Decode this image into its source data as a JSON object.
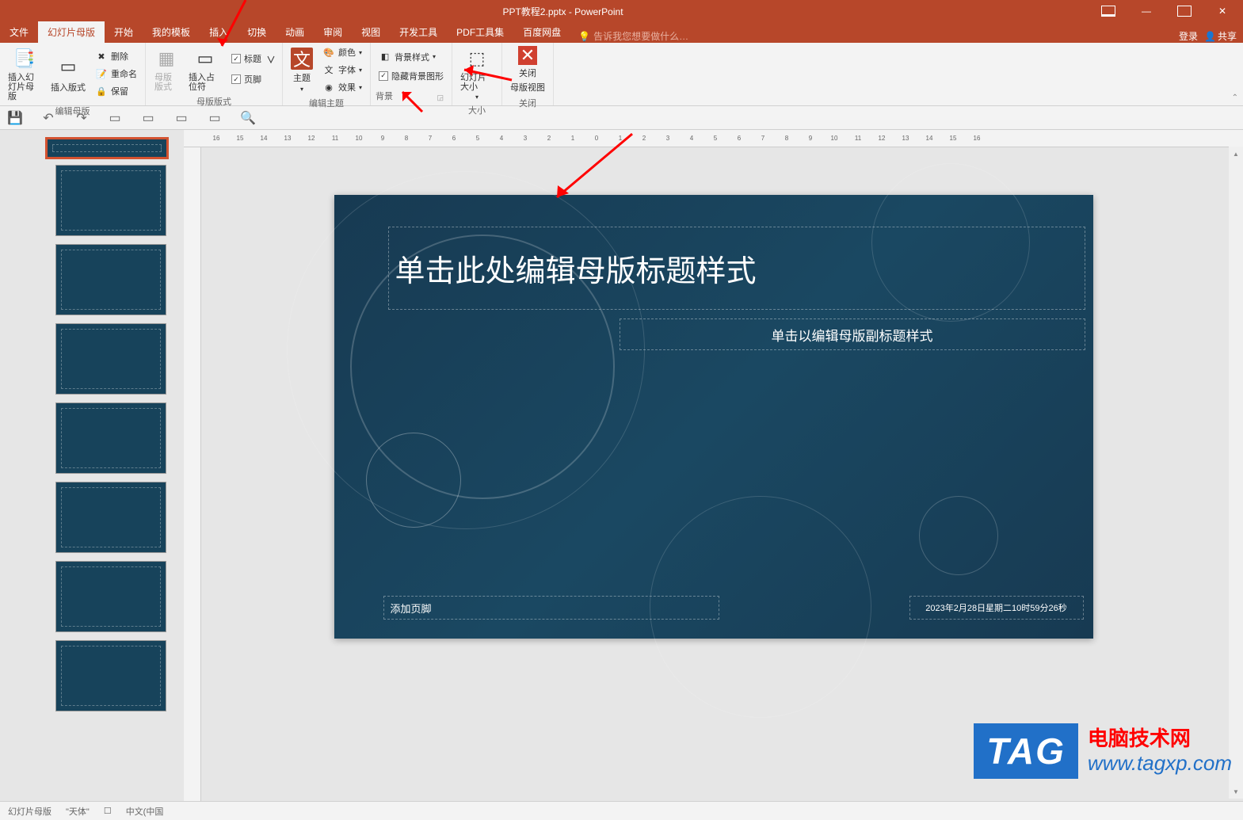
{
  "titlebar": {
    "title": "PPT教程2.pptx - PowerPoint",
    "login": "登录",
    "share": "共享",
    "min": "—",
    "max": "▢",
    "close": "✕"
  },
  "tabs": {
    "file": "文件",
    "slide_master": "幻灯片母版",
    "home": "开始",
    "my_templates": "我的模板",
    "insert": "插入",
    "transition": "切换",
    "animation": "动画",
    "review": "审阅",
    "view": "视图",
    "dev": "开发工具",
    "pdf": "PDF工具集",
    "baidu": "百度网盘",
    "tell": "告诉我您想要做什么…"
  },
  "ribbon": {
    "group_edit_master": "编辑母版",
    "insert_slide_master": "插入幻灯片母版",
    "insert_layout": "插入版式",
    "delete": "删除",
    "rename": "重命名",
    "preserve": "保留",
    "group_master_layout": "母版版式",
    "master_layout": "母版版式",
    "insert_placeholder": "插入占位符",
    "title": "标题",
    "footers": "页脚",
    "group_edit_theme": "编辑主题",
    "themes": "主题",
    "colors": "颜色",
    "fonts": "字体",
    "effects": "效果",
    "group_background": "背景",
    "background_styles": "背景样式",
    "hide_bg_graphics": "隐藏背景图形",
    "group_size": "大小",
    "slide_size": "幻灯片大小",
    "group_close": "关闭",
    "close_master_view1": "关闭",
    "close_master_view2": "母版视图"
  },
  "slide": {
    "title_placeholder": "单击此处编辑母版标题样式",
    "subtitle_placeholder": "单击以编辑母版副标题样式",
    "footer_placeholder": "添加页脚",
    "date_placeholder": "2023年2月28日星期二10时59分26秒"
  },
  "ruler": [
    "16",
    "15",
    "14",
    "13",
    "12",
    "11",
    "10",
    "9",
    "8",
    "7",
    "6",
    "5",
    "4",
    "3",
    "2",
    "1",
    "0",
    "1",
    "2",
    "3",
    "4",
    "5",
    "6",
    "7",
    "8",
    "9",
    "10",
    "11",
    "12",
    "13",
    "14",
    "15",
    "16"
  ],
  "statusbar": {
    "mode": "幻灯片母版",
    "theme": "\"天体\"",
    "lang_icon": "☐",
    "lang": "中文(中国"
  },
  "watermark": {
    "tag": "TAG",
    "line1": "电脑技术网",
    "line2": "www.tagxp.com"
  }
}
